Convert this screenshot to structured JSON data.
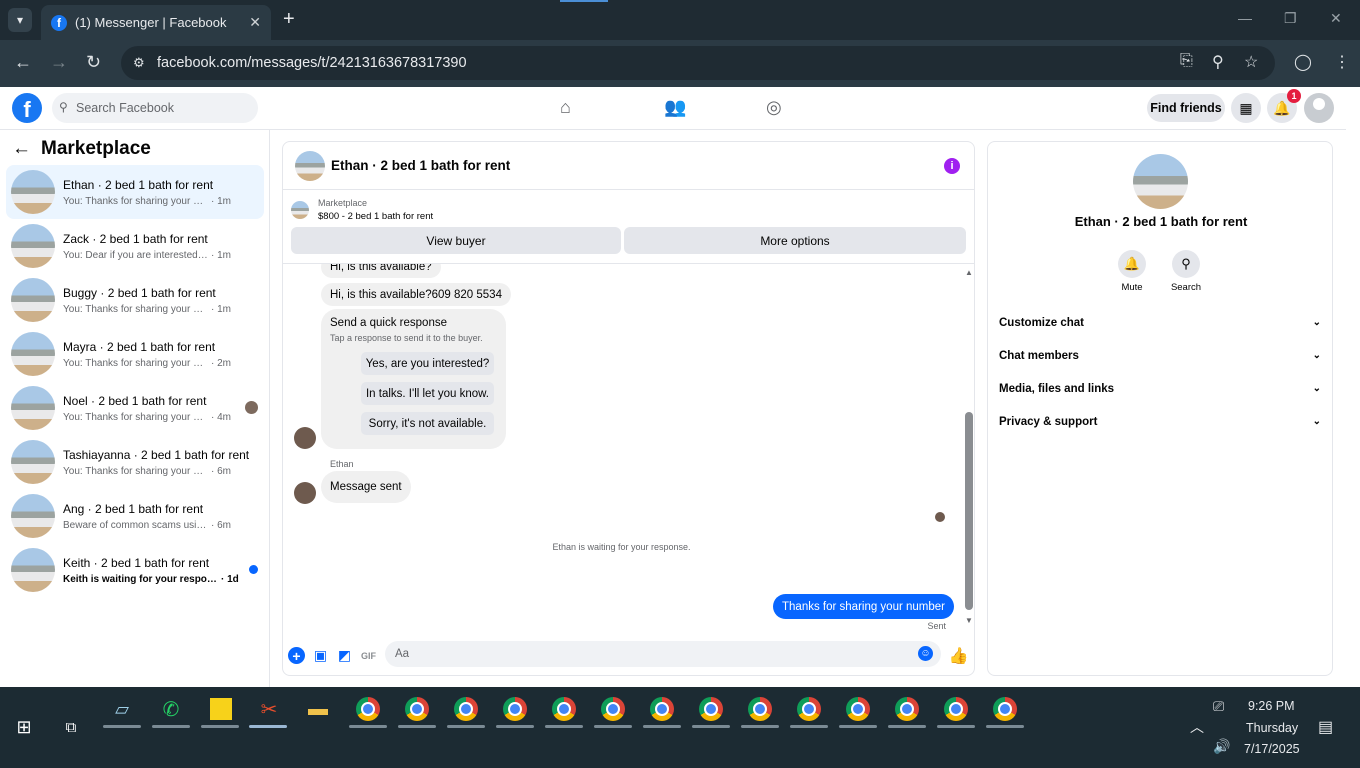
{
  "browser": {
    "tab_title": "(1) Messenger | Facebook",
    "url": "facebook.com/messages/t/24213163678317390"
  },
  "fb_header": {
    "search_placeholder": "Search Facebook",
    "find_friends": "Find friends",
    "notification_count": "1"
  },
  "sidebar": {
    "title": "Marketplace",
    "conversations": [
      {
        "name": "Ethan · 2 bed 1 bath for rent",
        "preview": "You: Thanks for sharing your number",
        "time": "· 1m"
      },
      {
        "name": "Zack · 2 bed 1 bath for rent",
        "preview": "You: Dear if you are interested, Send ...",
        "time": "· 1m"
      },
      {
        "name": "Buggy · 2 bed 1 bath for rent",
        "preview": "You: Thanks for sharing your number",
        "time": "· 1m"
      },
      {
        "name": "Mayra · 2 bed 1 bath for rent",
        "preview": "You: Thanks for sharing your number",
        "time": "· 2m"
      },
      {
        "name": "Noel · 2 bed 1 bath for rent",
        "preview": "You: Thanks for sharing your num...",
        "time": "· 4m"
      },
      {
        "name": "Tashiayanna · 2 bed 1 bath for rent",
        "preview": "You: Thanks for sharing your number",
        "time": "· 6m"
      },
      {
        "name": "Ang · 2 bed 1 bath for rent",
        "preview": "Beware of common scams using pay...",
        "time": "· 6m"
      },
      {
        "name": "Keith · 2 bed 1 bath for rent",
        "preview": "Keith is waiting for your response.",
        "time": "· 1d"
      }
    ]
  },
  "chat": {
    "title": "Ethan · 2 bed 1 bath for rent",
    "marketplace_label": "Marketplace",
    "listing": "$800 - 2 bed 1 bath for rent",
    "view_buyer": "View buyer",
    "more_options": "More options",
    "msg_1": "Hi, is this available?",
    "msg_2": "Hi, is this available?609 820 5534",
    "quick_title": "Send a quick response",
    "quick_sub": "Tap a response to send it to the buyer.",
    "quick_1": "Yes, are you interested?",
    "quick_2": "In talks. I'll let you know.",
    "quick_3": "Sorry, it's not available.",
    "sender": "Ethan",
    "msg_3": "Message sent",
    "waiting": "Ethan is waiting for your response.",
    "outgoing": "Thanks for sharing your number",
    "sent": "Sent",
    "composer_placeholder": "Aa"
  },
  "info": {
    "name": "Ethan · 2 bed 1 bath for rent",
    "mute": "Mute",
    "search": "Search",
    "rows": [
      "Customize chat",
      "Chat members",
      "Media, files and links",
      "Privacy & support"
    ]
  },
  "taskbar": {
    "time": "9:26 PM",
    "day": "Thursday",
    "date": "7/17/2025"
  }
}
